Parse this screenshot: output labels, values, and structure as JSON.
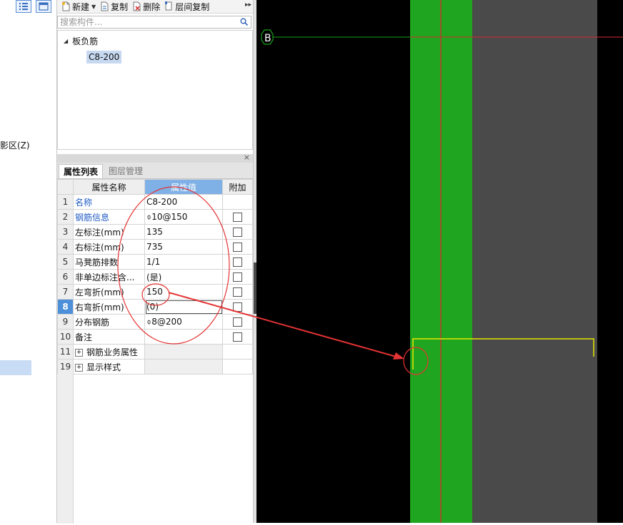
{
  "left_strip": {
    "label": "影区(Z)"
  },
  "toolbar": {
    "new_label": "新建",
    "copy_label": "复制",
    "delete_label": "删除",
    "floor_copy_label": "层间复制",
    "more": "▸▸"
  },
  "search": {
    "placeholder": "搜索构件..."
  },
  "tree": {
    "parent_label": "板负筋",
    "child_label": "C8-200"
  },
  "props_panel": {
    "close": "×",
    "tabs": [
      "属性列表",
      "图层管理"
    ],
    "columns": [
      "属性名称",
      "属性值",
      "附加"
    ],
    "rows": [
      {
        "num": "1",
        "name": "名称",
        "value": "C8-200",
        "checkbox": false
      },
      {
        "num": "2",
        "name": "钢筋信息",
        "value": "⌽10@150",
        "checkbox": true
      },
      {
        "num": "3",
        "name": "左标注(mm)",
        "value": "135",
        "checkbox": true
      },
      {
        "num": "4",
        "name": "右标注(mm)",
        "value": "735",
        "checkbox": true
      },
      {
        "num": "5",
        "name": "马凳筋排数",
        "value": "1/1",
        "checkbox": true
      },
      {
        "num": "6",
        "name": "非单边标注含...",
        "value": "(是)",
        "checkbox": true
      },
      {
        "num": "7",
        "name": "左弯折(mm)",
        "value": "150",
        "checkbox": true
      },
      {
        "num": "8",
        "name": "右弯折(mm)",
        "value": "(0)",
        "checkbox": true
      },
      {
        "num": "9",
        "name": "分布钢筋",
        "value": "⌽8@200",
        "checkbox": true
      },
      {
        "num": "10",
        "name": "备注",
        "value": "",
        "checkbox": true
      },
      {
        "num": "11",
        "name": "钢筋业务属性",
        "value": "",
        "checkbox": false
      },
      {
        "num": "19",
        "name": "显示样式",
        "value": "",
        "checkbox": false
      }
    ]
  },
  "canvas": {
    "axis_label": "B",
    "colors": {
      "background": "#000000",
      "beam": "#1fa51f",
      "slab": "#4a4a4a",
      "axis_line": "#d42a2a",
      "grid_line": "#1aa01a",
      "rebar": "#e8e800",
      "annotation": "#e53333"
    }
  }
}
